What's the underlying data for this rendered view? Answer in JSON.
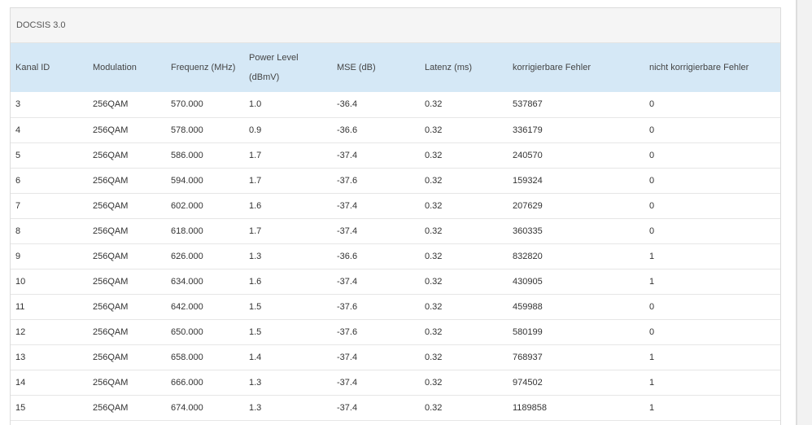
{
  "panel": {
    "title": "DOCSIS 3.0"
  },
  "table": {
    "headers": [
      {
        "line1": "Kanal ID",
        "line2": ""
      },
      {
        "line1": "Modulation",
        "line2": ""
      },
      {
        "line1": "Frequenz (MHz)",
        "line2": ""
      },
      {
        "line1": "Power Level",
        "line2": "(dBmV)"
      },
      {
        "line1": "MSE (dB)",
        "line2": ""
      },
      {
        "line1": "Latenz (ms)",
        "line2": ""
      },
      {
        "line1": "korrigierbare Fehler",
        "line2": ""
      },
      {
        "line1": "nicht korrigierbare Fehler",
        "line2": ""
      }
    ],
    "rows": [
      [
        "3",
        "256QAM",
        "570.000",
        "1.0",
        "-36.4",
        "0.32",
        "537867",
        "0"
      ],
      [
        "4",
        "256QAM",
        "578.000",
        "0.9",
        "-36.6",
        "0.32",
        "336179",
        "0"
      ],
      [
        "5",
        "256QAM",
        "586.000",
        "1.7",
        "-37.4",
        "0.32",
        "240570",
        "0"
      ],
      [
        "6",
        "256QAM",
        "594.000",
        "1.7",
        "-37.6",
        "0.32",
        "159324",
        "0"
      ],
      [
        "7",
        "256QAM",
        "602.000",
        "1.6",
        "-37.4",
        "0.32",
        "207629",
        "0"
      ],
      [
        "8",
        "256QAM",
        "618.000",
        "1.7",
        "-37.4",
        "0.32",
        "360335",
        "0"
      ],
      [
        "9",
        "256QAM",
        "626.000",
        "1.3",
        "-36.6",
        "0.32",
        "832820",
        "1"
      ],
      [
        "10",
        "256QAM",
        "634.000",
        "1.6",
        "-37.4",
        "0.32",
        "430905",
        "1"
      ],
      [
        "11",
        "256QAM",
        "642.000",
        "1.5",
        "-37.6",
        "0.32",
        "459988",
        "0"
      ],
      [
        "12",
        "256QAM",
        "650.000",
        "1.5",
        "-37.6",
        "0.32",
        "580199",
        "0"
      ],
      [
        "13",
        "256QAM",
        "658.000",
        "1.4",
        "-37.4",
        "0.32",
        "768937",
        "1"
      ],
      [
        "14",
        "256QAM",
        "666.000",
        "1.3",
        "-37.4",
        "0.32",
        "974502",
        "1"
      ],
      [
        "15",
        "256QAM",
        "674.000",
        "1.3",
        "-37.4",
        "0.32",
        "1189858",
        "1"
      ]
    ]
  },
  "colors": {
    "header_bg": "#d5e8f6",
    "title_bg": "#f5f5f5",
    "row_border": "#e6e6e6"
  }
}
